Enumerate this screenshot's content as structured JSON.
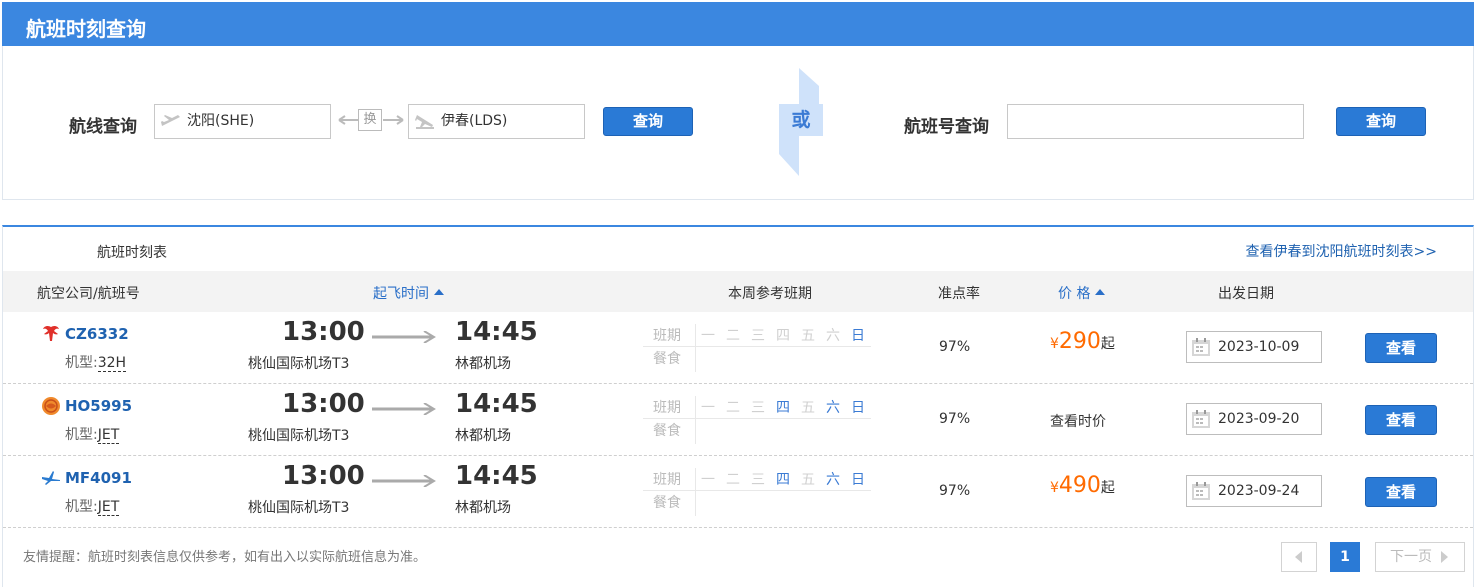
{
  "header": {
    "title": "航班时刻查询"
  },
  "route_search": {
    "label": "航线查询",
    "from_value": "沈阳(SHE)",
    "swap_label": "换",
    "to_value": "伊春(LDS)",
    "search_label": "查询"
  },
  "or_label": "或",
  "flight_search": {
    "label": "航班号查询",
    "value": "",
    "search_label": "查询"
  },
  "schedule": {
    "title": "航班时刻表",
    "reverse_link": "查看伊春到沈阳航班时刻表>>",
    "columns": {
      "airline": "航空公司/航班号",
      "departure": "起飞时间",
      "week": "本周参考班期",
      "ontime": "准点率",
      "price": "价 格",
      "date": "出发日期"
    },
    "week_labels": {
      "schedule": "班期",
      "meal": "餐食"
    },
    "days": [
      "一",
      "二",
      "三",
      "四",
      "五",
      "六",
      "日"
    ],
    "model_label": "机型:",
    "currency": "¥",
    "from_suffix": "起",
    "action_label": "查看",
    "flights": [
      {
        "flight_no": "CZ6332",
        "model": "32H",
        "airline_icon": "china-southern-logo-icon",
        "dep_time": "13:00",
        "dep_airport": "桃仙国际机场T3",
        "arr_time": "14:45",
        "arr_airport": "林都机场",
        "active_days": [
          false,
          false,
          false,
          false,
          false,
          false,
          true
        ],
        "ontime": "97%",
        "price": "290",
        "price_text": "",
        "date": "2023-10-09"
      },
      {
        "flight_no": "HO5995",
        "model": "JET",
        "airline_icon": "juneyao-logo-icon",
        "dep_time": "13:00",
        "dep_airport": "桃仙国际机场T3",
        "arr_time": "14:45",
        "arr_airport": "林都机场",
        "active_days": [
          false,
          false,
          false,
          true,
          false,
          true,
          true
        ],
        "ontime": "97%",
        "price": "",
        "price_text": "查看时价",
        "date": "2023-09-20"
      },
      {
        "flight_no": "MF4091",
        "model": "JET",
        "airline_icon": "xiamen-air-logo-icon",
        "dep_time": "13:00",
        "dep_airport": "桃仙国际机场T3",
        "arr_time": "14:45",
        "arr_airport": "林都机场",
        "active_days": [
          false,
          false,
          false,
          true,
          false,
          true,
          true
        ],
        "ontime": "97%",
        "price": "490",
        "price_text": "",
        "date": "2023-09-24"
      }
    ]
  },
  "footer": {
    "note": "友情提醒：航班时刻表信息仅供参考，如有出入以实际航班信息为准。",
    "current_page": "1",
    "next_label": "下一页"
  },
  "colors": {
    "brand": "#3b87e0",
    "button": "#2a7ad6",
    "link": "#1f62b0",
    "price": "#ff6a00"
  }
}
